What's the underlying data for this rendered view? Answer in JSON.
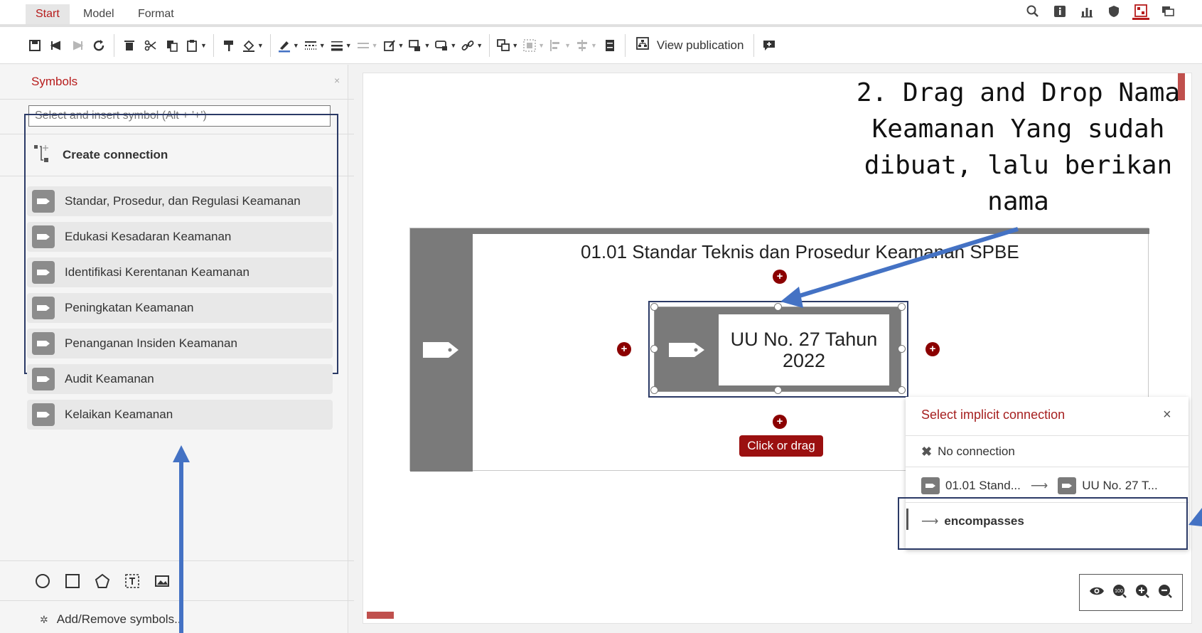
{
  "menu": {
    "tabs": [
      {
        "label": "Start",
        "active": true
      },
      {
        "label": "Model",
        "active": false
      },
      {
        "label": "Format",
        "active": false
      }
    ],
    "right_icons": [
      "search-icon",
      "info-icon",
      "bar-chart-icon",
      "shield-icon",
      "model-symbol-icon",
      "chat-icon"
    ]
  },
  "toolbar": {
    "view_publication_label": "View publication"
  },
  "panel": {
    "title": "Symbols",
    "close": "×",
    "search_placeholder": "Select and insert symbol (Alt + '+')",
    "create_connection": "Create connection",
    "items": [
      {
        "label": "Standar, Prosedur, dan Regulasi Keamanan"
      },
      {
        "label": "Edukasi Kesadaran Keamanan"
      },
      {
        "label": "Identifikasi Kerentanan Keamanan"
      },
      {
        "label": "Peningkatan Keamanan"
      },
      {
        "label": "Penanganan Insiden Keamanan"
      },
      {
        "label": "Audit Keamanan"
      },
      {
        "label": "Kelaikan Keamanan"
      }
    ],
    "shape_icons": [
      "circle-icon",
      "square-icon",
      "pentagon-icon",
      "text-box-icon",
      "image-icon"
    ],
    "add_remove": "Add/Remove symbols..."
  },
  "canvas": {
    "instruction": "2. Drag and Drop Nama Keamanan Yang sudah dibuat, lalu berikan nama",
    "container_title": "01.01 Standar Teknis dan Prosedur Keamanan SPBE",
    "symbol_label": "UU No. 27 Tahun 2022",
    "click_or_drag": "Click or drag",
    "add_symbol": "+"
  },
  "popup": {
    "title": "Select implicit connection",
    "close": "×",
    "no_connection": "No connection",
    "from": "01.01 Stand...",
    "to": "UU No. 27 T...",
    "relation": "encompasses"
  },
  "zoom": {
    "icons": [
      "eye-icon",
      "zoom-100-icon",
      "zoom-in-icon",
      "zoom-out-icon"
    ],
    "zoom_100": "100"
  },
  "colors": {
    "accent": "#b71c1c",
    "annotation_blue": "#4472c4",
    "symbol_gray": "#7a7a7a",
    "selection_navy": "#2b3a66"
  }
}
